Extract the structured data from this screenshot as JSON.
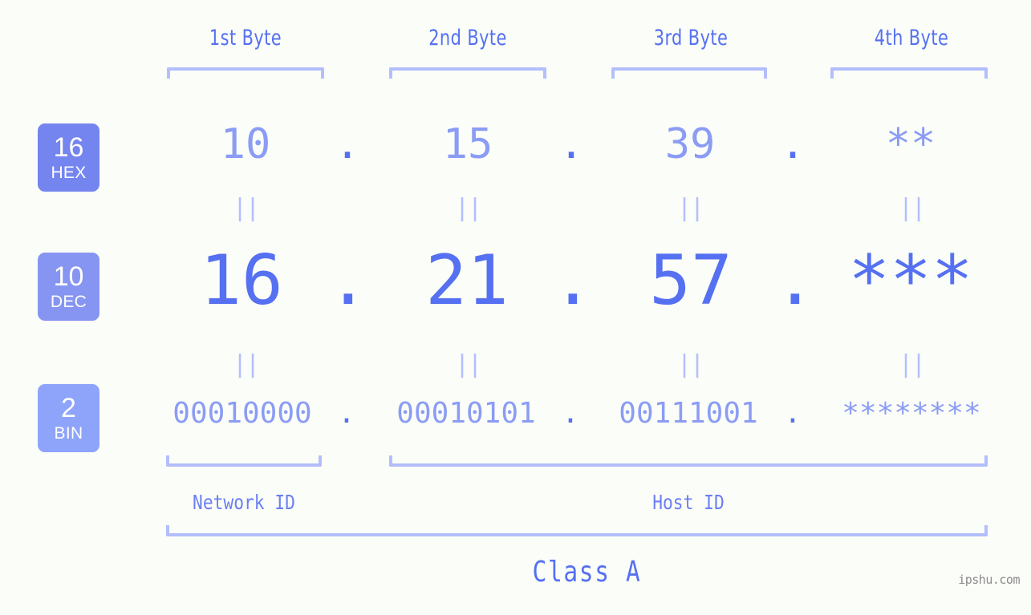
{
  "byte_headers": [
    {
      "label": "1st Byte"
    },
    {
      "label": "2nd Byte"
    },
    {
      "label": "3rd Byte"
    },
    {
      "label": "4th Byte"
    }
  ],
  "bases": [
    {
      "num": "16",
      "name": "HEX",
      "color": "#7485ef"
    },
    {
      "num": "10",
      "name": "DEC",
      "color": "#8795f2"
    },
    {
      "num": "2",
      "name": "BIN",
      "color": "#8ea4fa"
    }
  ],
  "rows": {
    "hex": {
      "base_num": "16",
      "base_name": "HEX",
      "values": [
        "10",
        "15",
        "39",
        "**"
      ],
      "separator": "."
    },
    "dec": {
      "base_num": "10",
      "base_name": "DEC",
      "values": [
        "16",
        "21",
        "57",
        "***"
      ],
      "separator": "."
    },
    "bin": {
      "base_num": "2",
      "base_name": "BIN",
      "values": [
        "00010000",
        "00010101",
        "00111001",
        "********"
      ],
      "separator": "."
    }
  },
  "equals_marks": {
    "glyph": "||"
  },
  "segments": {
    "network_id": "Network ID",
    "host_id": "Host ID",
    "class": "Class A"
  },
  "watermark": "ipshu.com",
  "colors": {
    "background": "#fbfdf8",
    "accent_strong": "#5570f1",
    "accent_mid": "#8b9cf5",
    "accent_light": "#b3bffc"
  }
}
